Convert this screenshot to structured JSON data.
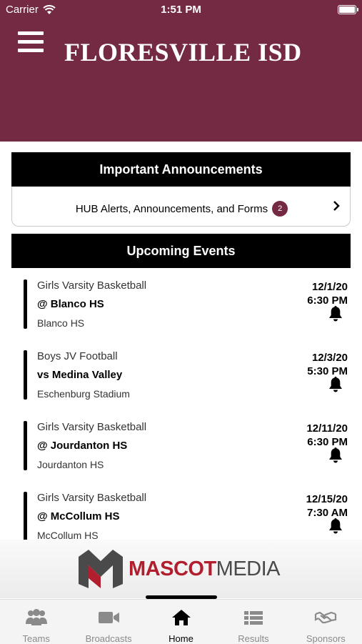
{
  "status_bar": {
    "carrier": "Carrier",
    "time": "1:51 PM"
  },
  "header": {
    "title": "FLORESVILLE ISD",
    "color": "#742a42"
  },
  "announcements": {
    "title": "Important Announcements",
    "row_label": "HUB Alerts, Announcements, and Forms",
    "badge_count": "2"
  },
  "events": {
    "title": "Upcoming Events",
    "items": [
      {
        "sport": "Girls Varsity Basketball",
        "opponent": "@ Blanco HS",
        "location": "Blanco HS",
        "date": "12/1/20",
        "time": "6:30 PM"
      },
      {
        "sport": "Boys JV Football",
        "opponent": "vs Medina Valley",
        "location": "Eschenburg Stadium",
        "date": "12/3/20",
        "time": "5:30 PM"
      },
      {
        "sport": "Girls Varsity Basketball",
        "opponent": "@ Jourdanton HS",
        "location": "Jourdanton HS",
        "date": "12/11/20",
        "time": "6:30 PM"
      },
      {
        "sport": "Girls Varsity Basketball",
        "opponent": "@ McCollum HS",
        "location": "McCollum HS",
        "date": "12/15/20",
        "time": "7:30 AM"
      }
    ]
  },
  "sponsor": {
    "brand_part1": "MASCOT",
    "brand_part2": "MEDIA"
  },
  "tabs": [
    {
      "label": "Teams",
      "icon": "teams-icon"
    },
    {
      "label": "Broadcasts",
      "icon": "video-camera-icon"
    },
    {
      "label": "Home",
      "icon": "home-icon",
      "active": true
    },
    {
      "label": "Results",
      "icon": "list-icon"
    },
    {
      "label": "Sponsors",
      "icon": "handshake-icon"
    }
  ]
}
